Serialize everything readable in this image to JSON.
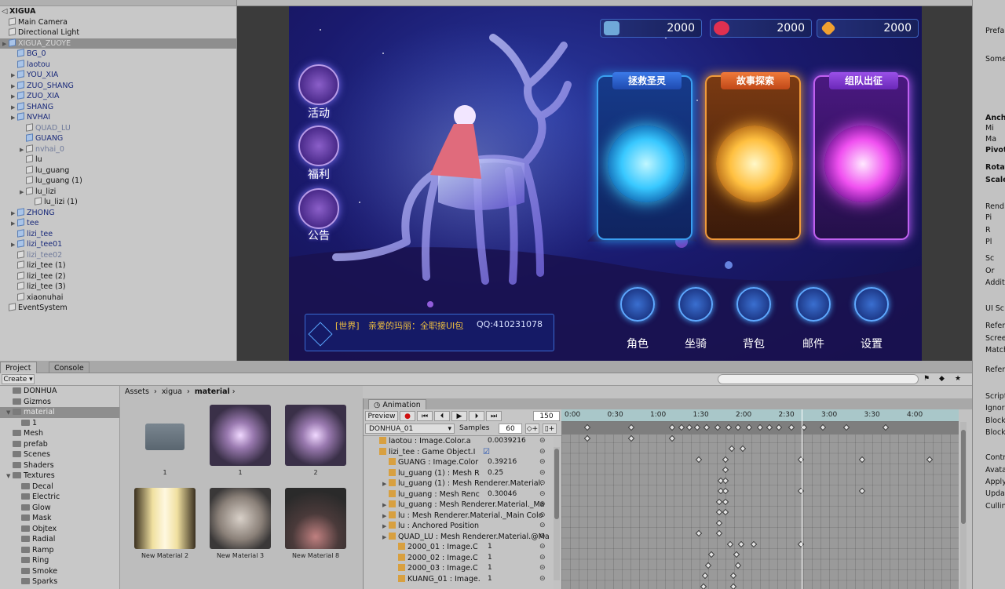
{
  "hierarchy": {
    "scene": "XIGUA",
    "rows": [
      {
        "label": "Main Camera",
        "indent": 1,
        "arrow": false,
        "style": ""
      },
      {
        "label": "Directional Light",
        "indent": 1,
        "arrow": false,
        "style": ""
      },
      {
        "label": "XIGUA_ZUOYE",
        "indent": 1,
        "arrow": true,
        "style": "sel"
      },
      {
        "label": "BG_0",
        "indent": 2,
        "arrow": false,
        "style": "blue"
      },
      {
        "label": "laotou",
        "indent": 2,
        "arrow": false,
        "style": "blue"
      },
      {
        "label": "YOU_XIA",
        "indent": 2,
        "arrow": true,
        "style": "blue"
      },
      {
        "label": "ZUO_SHANG",
        "indent": 2,
        "arrow": true,
        "style": "blue"
      },
      {
        "label": "ZUO_XIA",
        "indent": 2,
        "arrow": true,
        "style": "blue"
      },
      {
        "label": "SHANG",
        "indent": 2,
        "arrow": true,
        "style": "blue"
      },
      {
        "label": "NVHAI",
        "indent": 2,
        "arrow": true,
        "style": "blue"
      },
      {
        "label": "QUAD_LU",
        "indent": 3,
        "arrow": false,
        "style": "dim"
      },
      {
        "label": "GUANG",
        "indent": 3,
        "arrow": false,
        "style": "blue"
      },
      {
        "label": "nvhai_0",
        "indent": 3,
        "arrow": true,
        "style": "dim"
      },
      {
        "label": "lu",
        "indent": 3,
        "arrow": false,
        "style": ""
      },
      {
        "label": "lu_guang",
        "indent": 3,
        "arrow": false,
        "style": ""
      },
      {
        "label": "lu_guang (1)",
        "indent": 3,
        "arrow": false,
        "style": ""
      },
      {
        "label": "lu_lizi",
        "indent": 3,
        "arrow": true,
        "style": ""
      },
      {
        "label": "lu_lizi (1)",
        "indent": 4,
        "arrow": false,
        "style": ""
      },
      {
        "label": "ZHONG",
        "indent": 2,
        "arrow": true,
        "style": "blue"
      },
      {
        "label": "tee",
        "indent": 2,
        "arrow": true,
        "style": "blue"
      },
      {
        "label": "lizi_tee",
        "indent": 2,
        "arrow": false,
        "style": "blue"
      },
      {
        "label": "lizi_tee01",
        "indent": 2,
        "arrow": true,
        "style": "blue"
      },
      {
        "label": "lizi_tee02",
        "indent": 2,
        "arrow": false,
        "style": "dim"
      },
      {
        "label": "lizi_tee (1)",
        "indent": 2,
        "arrow": false,
        "style": ""
      },
      {
        "label": "lizi_tee (2)",
        "indent": 2,
        "arrow": false,
        "style": ""
      },
      {
        "label": "lizi_tee (3)",
        "indent": 2,
        "arrow": false,
        "style": ""
      },
      {
        "label": "xiaonuhai",
        "indent": 2,
        "arrow": false,
        "style": ""
      },
      {
        "label": "EventSystem",
        "indent": 1,
        "arrow": false,
        "style": ""
      }
    ]
  },
  "game": {
    "resources": [
      "2000",
      "2000",
      "2000"
    ],
    "left_buttons": [
      "活动",
      "福利",
      "公告"
    ],
    "cards": [
      {
        "title": "拯救圣灵"
      },
      {
        "title": "故事探索"
      },
      {
        "title": "组队出征"
      }
    ],
    "bottom_buttons": [
      "角色",
      "坐骑",
      "背包",
      "邮件",
      "设置"
    ],
    "chat": {
      "channel": "[世界]",
      "text": "亲爱的玛丽：全职接UI包",
      "qq": "QQ:410231078"
    }
  },
  "project": {
    "tabs": [
      "Project",
      "Console"
    ],
    "create_label": "Create",
    "tree": [
      {
        "label": "DONHUA",
        "indent": 2,
        "arrow": false,
        "sel": false
      },
      {
        "label": "Gizmos",
        "indent": 2,
        "arrow": false,
        "sel": false
      },
      {
        "label": "material",
        "indent": 2,
        "arrow": true,
        "sel": true
      },
      {
        "label": "1",
        "indent": 3,
        "arrow": false,
        "sel": false
      },
      {
        "label": "Mesh",
        "indent": 2,
        "arrow": false,
        "sel": false
      },
      {
        "label": "prefab",
        "indent": 2,
        "arrow": false,
        "sel": false
      },
      {
        "label": "Scenes",
        "indent": 2,
        "arrow": false,
        "sel": false
      },
      {
        "label": "Shaders",
        "indent": 2,
        "arrow": false,
        "sel": false
      },
      {
        "label": "Textures",
        "indent": 2,
        "arrow": true,
        "sel": false
      },
      {
        "label": "Decal",
        "indent": 3,
        "arrow": false,
        "sel": false
      },
      {
        "label": "Electric",
        "indent": 3,
        "arrow": false,
        "sel": false
      },
      {
        "label": "Glow",
        "indent": 3,
        "arrow": false,
        "sel": false
      },
      {
        "label": "Mask",
        "indent": 3,
        "arrow": false,
        "sel": false
      },
      {
        "label": "Objtex",
        "indent": 3,
        "arrow": false,
        "sel": false
      },
      {
        "label": "Radial",
        "indent": 3,
        "arrow": false,
        "sel": false
      },
      {
        "label": "Ramp",
        "indent": 3,
        "arrow": false,
        "sel": false
      },
      {
        "label": "Ring",
        "indent": 3,
        "arrow": false,
        "sel": false
      },
      {
        "label": "Smoke",
        "indent": 3,
        "arrow": false,
        "sel": false
      },
      {
        "label": "Sparks",
        "indent": 3,
        "arrow": false,
        "sel": false
      }
    ],
    "breadcrumb": [
      "Assets",
      "xigua",
      "material"
    ],
    "assets": [
      {
        "label": "1",
        "kind": "folder"
      },
      {
        "label": "1",
        "kind": "mat-a"
      },
      {
        "label": "2",
        "kind": "mat-a"
      },
      {
        "label": "New Material 2",
        "kind": "mat-b"
      },
      {
        "label": "New Material 3",
        "kind": "mat-c"
      },
      {
        "label": "New Material 8",
        "kind": "mat-d"
      }
    ]
  },
  "animation": {
    "tab": "Animation",
    "preview": "Preview",
    "frame": "150",
    "clip": "DONHUA_01",
    "samples_label": "Samples",
    "samples": "60",
    "ruler": [
      "0:00",
      "0:30",
      "1:00",
      "1:30",
      "2:00",
      "2:30",
      "3:00",
      "3:30",
      "4:00"
    ],
    "props": [
      {
        "label": "laotou : Image.Color.a",
        "value": "0.0039216",
        "indent": 1,
        "arrow": false
      },
      {
        "label": "lizi_tee : Game Object.I",
        "value": "",
        "indent": 1,
        "arrow": false,
        "check": true
      },
      {
        "label": "GUANG : Image.Color",
        "value": "0.39216",
        "indent": 2,
        "arrow": false
      },
      {
        "label": "lu_guang (1) : Mesh R",
        "value": "0.25",
        "indent": 2,
        "arrow": false
      },
      {
        "label": "lu_guang (1) : Mesh Renderer.Material.",
        "value": "",
        "indent": 2,
        "arrow": true
      },
      {
        "label": "lu_guang : Mesh Renc",
        "value": "0.30046",
        "indent": 2,
        "arrow": false
      },
      {
        "label": "lu_guang : Mesh Renderer.Material._Ma",
        "value": "",
        "indent": 2,
        "arrow": true
      },
      {
        "label": "lu : Mesh Renderer.Material._Main Colo",
        "value": "",
        "indent": 2,
        "arrow": true
      },
      {
        "label": "lu : Anchored Position",
        "value": "",
        "indent": 2,
        "arrow": true
      },
      {
        "label": "QUAD_LU : Mesh Renderer.Material.@Ma",
        "value": "",
        "indent": 2,
        "arrow": true
      },
      {
        "label": "2000_01 : Image.C",
        "value": "1",
        "indent": 3,
        "arrow": false
      },
      {
        "label": "2000_02 : Image.C",
        "value": "1",
        "indent": 3,
        "arrow": false
      },
      {
        "label": "2000_03 : Image.C",
        "value": "1",
        "indent": 3,
        "arrow": false
      },
      {
        "label": "KUANG_01 : Image.",
        "value": "1",
        "indent": 3,
        "arrow": false
      }
    ]
  },
  "inspector": {
    "labels": [
      "Prefa",
      "Some",
      "Anch",
      "Mi",
      "Ma",
      "Pivot",
      "Rotat",
      "Scale",
      "Rend",
      "Pi",
      "R",
      "Pl",
      "Sc",
      "Or",
      "Additi",
      "UI Sc",
      "Refer",
      "Scree",
      "Match",
      "Refer",
      "Script",
      "Ignor",
      "Block",
      "Block",
      "Contr",
      "Avata",
      "Apply",
      "Updat",
      "Cullin"
    ]
  }
}
